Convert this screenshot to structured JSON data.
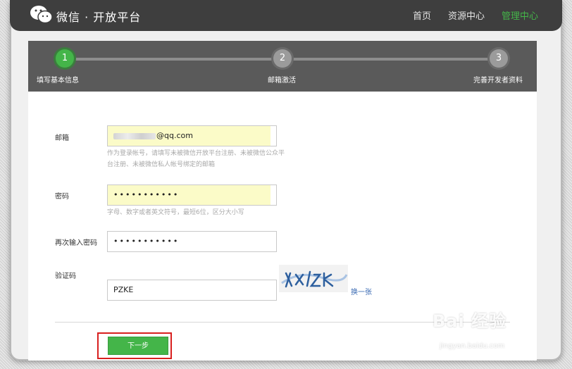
{
  "header": {
    "logo_icon": "wechat-logo-icon",
    "title": "微信 · 开放平台",
    "nav": [
      {
        "label": "首页"
      },
      {
        "label": "资源中心"
      },
      {
        "label": "管理中心",
        "active": true
      }
    ]
  },
  "steps": [
    {
      "number": "1",
      "label": "填写基本信息",
      "active": true
    },
    {
      "number": "2",
      "label": "邮箱激活",
      "active": false
    },
    {
      "number": "3",
      "label": "完善开发者资料",
      "active": false
    }
  ],
  "form": {
    "email": {
      "label": "邮箱",
      "value": "@qq.com",
      "hint": "作为登录帐号，请填写未被微信开放平台注册、未被微信公众平台注册、未被微信私人帐号绑定的邮箱"
    },
    "password": {
      "label": "密码",
      "value": "•••••••••••",
      "hint": "字母、数字或者英文符号，最短6位，区分大小写"
    },
    "confirm_password": {
      "label": "再次输入密码",
      "value": "•••••••••••"
    },
    "captcha": {
      "label": "验证码",
      "value": "PZKE",
      "refresh_label": "换一张"
    },
    "submit_label": "下一步"
  },
  "watermark": {
    "logo": "Bai 经验",
    "url": "jingyan.baidu.com"
  },
  "colors": {
    "accent": "#44b549",
    "header_bg": "#3e3e3e",
    "steps_bg": "#5a5a5a",
    "highlight": "#d8201f"
  }
}
